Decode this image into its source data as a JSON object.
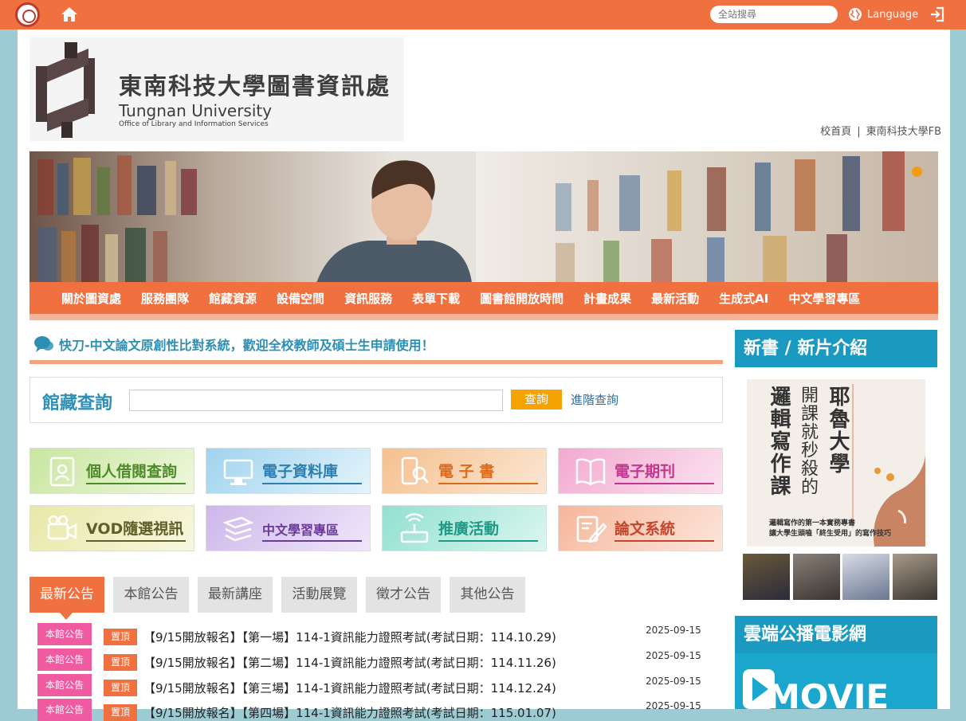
{
  "topbar": {
    "search_placeholder": "全站搜尋",
    "language_label": "Language"
  },
  "brand": {
    "title_zh": "東南科技大學圖書資訊處",
    "title_en": "Tungnan University",
    "subtitle_en": "Office of Library and Information Services"
  },
  "toplinks": {
    "home": "校首頁",
    "separator": "|",
    "fb": "東南科技大學FB"
  },
  "nav": [
    "關於圖資處",
    "服務團隊",
    "館藏資源",
    "設備空間",
    "資訊服務",
    "表單下載",
    "圖書館開放時間",
    "計畫成果",
    "最新活動",
    "生成式AI",
    "中文學習專區"
  ],
  "marquee": "快刀-中文論文原創性比對系統，歡迎全校教師及碩士生申請使用！",
  "catalog": {
    "title": "館藏查詢",
    "button": "查詢",
    "advanced": "進階查詢"
  },
  "tiles": [
    {
      "label": "個人借閱查詢",
      "color": "#4e8a2a"
    },
    {
      "label": "電子資料庫",
      "color": "#2d7fb0"
    },
    {
      "label": "電 子 書",
      "color": "#d96a1e"
    },
    {
      "label": "電子期刊",
      "color": "#c0378c"
    },
    {
      "label": "VOD隨選視訊",
      "color": "#5f5f2a"
    },
    {
      "label": "中文學習專區",
      "color": "#6a3b9a"
    },
    {
      "label": "推廣活動",
      "color": "#1f9a86"
    },
    {
      "label": "論文系統",
      "color": "#c4452a"
    }
  ],
  "tabs": [
    "最新公告",
    "本館公告",
    "最新講座",
    "活動展覽",
    "徵才公告",
    "其他公告"
  ],
  "news": [
    {
      "category": "本館公告",
      "pin": "置頂",
      "title": "【9/15開放報名】【第一場】114-1資訊能力證照考試(考試日期：114.10.29)",
      "date": "2025-09-15"
    },
    {
      "category": "本館公告",
      "pin": "置頂",
      "title": "【9/15開放報名】【第二場】114-1資訊能力證照考試(考試日期：114.11.26)",
      "date": "2025-09-15"
    },
    {
      "category": "本館公告",
      "pin": "置頂",
      "title": "【9/15開放報名】【第三場】114-1資訊能力證照考試(考試日期：114.12.24)",
      "date": "2025-09-15"
    },
    {
      "category": "本館公告",
      "pin": "置頂",
      "title": "【9/15開放報名】【第四場】114-1資訊能力證照考試(考試日期：115.01.07)",
      "date": "2025-09-15"
    }
  ],
  "sidebar": {
    "new_books_title": "新書 / 新片介紹",
    "featured_book": {
      "title_line1": "開課就秒殺的",
      "title_line2": "耶魯大學",
      "title_line3": "邏輯寫作課",
      "blurb_line1": "邏輯寫作的第一本實務專書",
      "blurb_line2": "讓大學生頭嗑「終生受用」的寫作技巧"
    },
    "cloud_title": "雲端公播電影網",
    "kmovie_label": "MOVIE"
  },
  "colors": {
    "accent": "#f07040",
    "link": "#2c8fb3",
    "sidebar_header": "#1a99c1"
  }
}
